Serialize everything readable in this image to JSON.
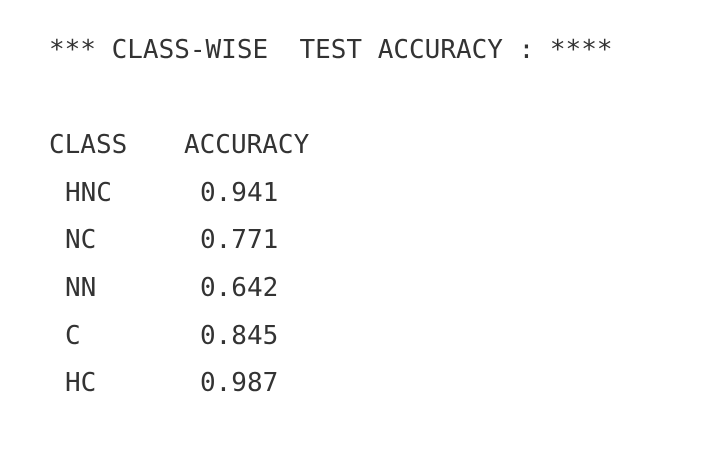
{
  "output": {
    "title": "*** CLASS-WISE  TEST ACCURACY : ****",
    "header": {
      "class": "CLASS",
      "accuracy": "ACCURACY"
    },
    "rows": [
      {
        "class": "HNC",
        "accuracy": "0.941"
      },
      {
        "class": "NC",
        "accuracy": "0.771"
      },
      {
        "class": "NN",
        "accuracy": "0.642"
      },
      {
        "class": "C",
        "accuracy": "0.845"
      },
      {
        "class": "HC",
        "accuracy": "0.987"
      }
    ]
  }
}
